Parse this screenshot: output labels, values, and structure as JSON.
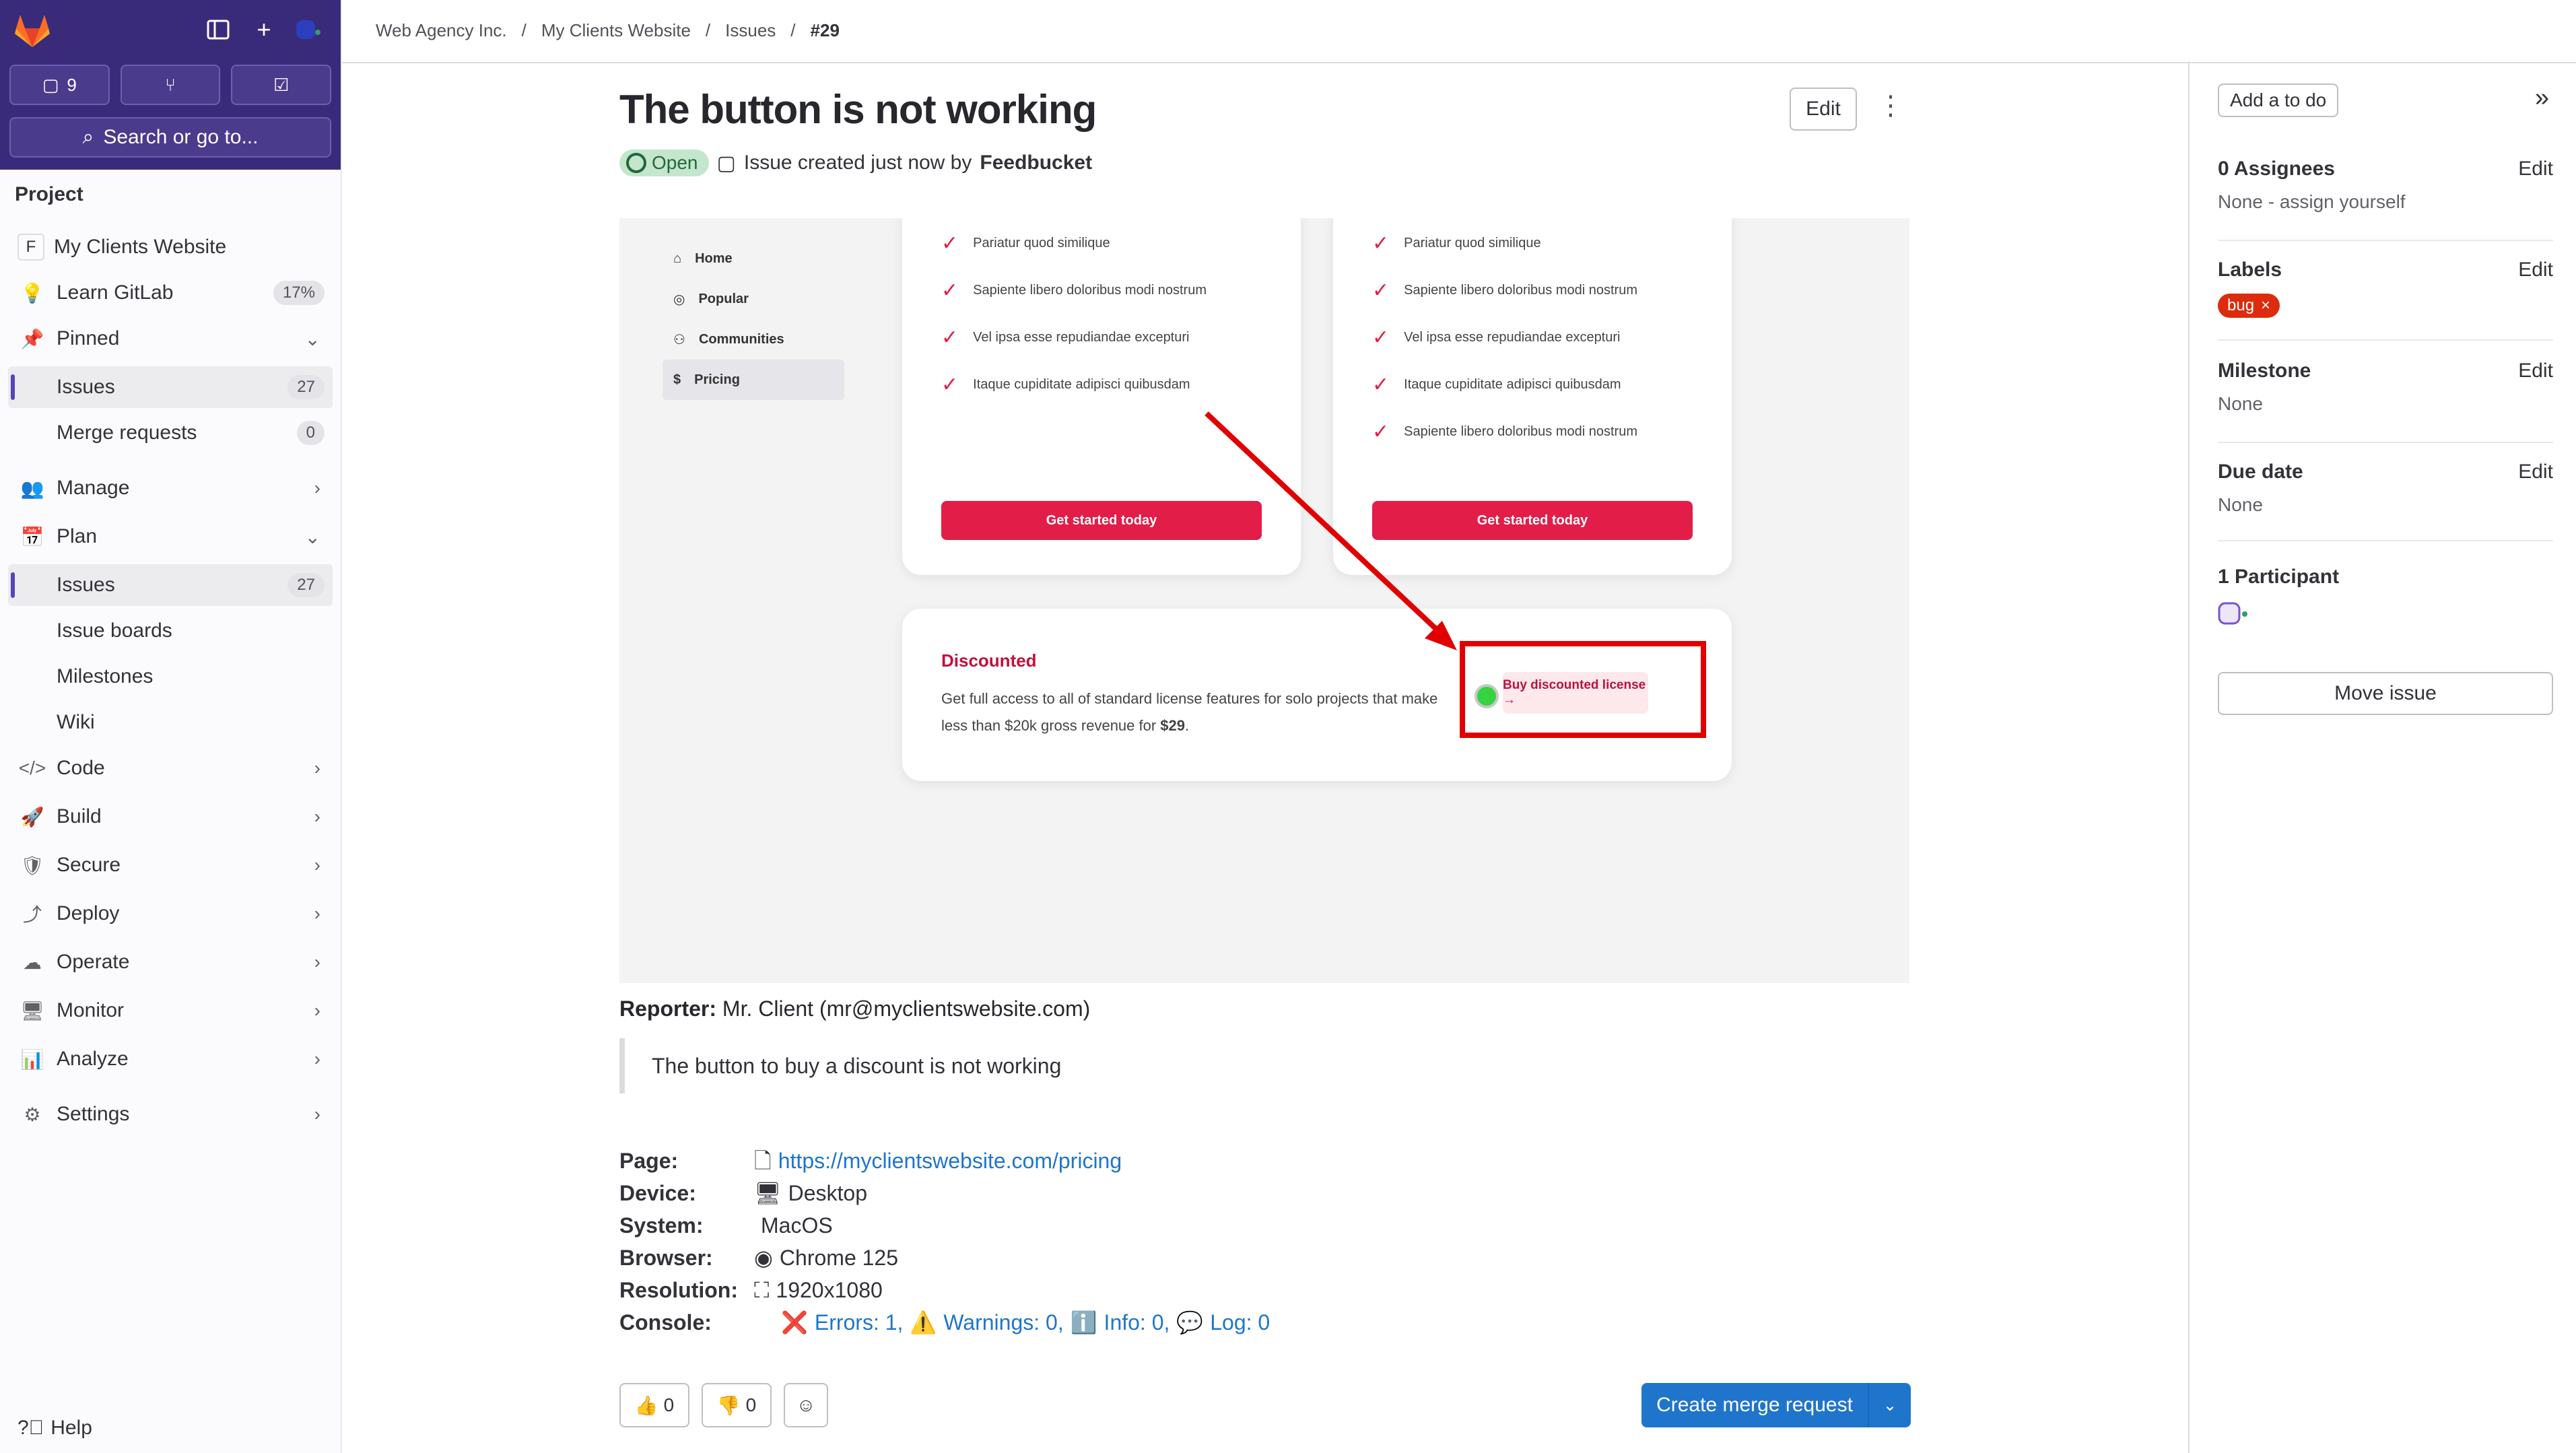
{
  "sidebar": {
    "counts": {
      "issues": "9"
    },
    "search_label": "Search or go to...",
    "section_label": "Project",
    "project_initial": "F",
    "project_name": "My Clients Website",
    "learn": {
      "label": "Learn GitLab",
      "badge": "17%"
    },
    "pinned": "Pinned",
    "pinned_issues": {
      "label": "Issues",
      "count": "27"
    },
    "pinned_mrs": {
      "label": "Merge requests",
      "count": "0"
    },
    "manage": "Manage",
    "plan": "Plan",
    "plan_issues": {
      "label": "Issues",
      "count": "27"
    },
    "issue_boards": "Issue boards",
    "milestones": "Milestones",
    "wiki": "Wiki",
    "code": "Code",
    "build": "Build",
    "secure": "Secure",
    "deploy": "Deploy",
    "operate": "Operate",
    "monitor": "Monitor",
    "analyze": "Analyze",
    "settings": "Settings",
    "help": "Help"
  },
  "breadcrumb": [
    "Web Agency Inc.",
    "My Clients Website",
    "Issues",
    "#29"
  ],
  "issue": {
    "title": "The button is not working",
    "status": "Open",
    "created_text": "Issue created just now by",
    "author": "Feedbucket",
    "edit_label": "Edit"
  },
  "screenshot": {
    "nav": [
      "Home",
      "Popular",
      "Communities",
      "Pricing"
    ],
    "card1_features": [
      "Pariatur quod similique",
      "Sapiente libero doloribus modi nostrum",
      "Vel ipsa esse repudiandae excepturi",
      "Itaque cupiditate adipisci quibusdam"
    ],
    "card2_features": [
      "Pariatur quod similique",
      "Sapiente libero doloribus modi nostrum",
      "Vel ipsa esse repudiandae excepturi",
      "Itaque cupiditate adipisci quibusdam",
      "Sapiente libero doloribus modi nostrum"
    ],
    "cta_label": "Get started today",
    "discount_title": "Discounted",
    "discount_text_a": "Get full access to all of standard license features for solo projects that make less than $20k gross revenue for ",
    "discount_price": "$29",
    "discount_text_b": ".",
    "discount_button": "Buy discounted license →"
  },
  "reporter": {
    "label": "Reporter:",
    "value": "Mr. Client (mr@myclientswebsite.com)"
  },
  "quote": "The button to buy a discount is not working",
  "details": {
    "page": {
      "k": "Page:",
      "v": "https://myclientswebsite.com/pricing"
    },
    "device": {
      "k": "Device:",
      "v": "Desktop"
    },
    "system": {
      "k": "System:",
      "v": "MacOS"
    },
    "browser": {
      "k": "Browser:",
      "v": "Chrome 125"
    },
    "resolution": {
      "k": "Resolution:",
      "v": "1920x1080"
    },
    "console": {
      "k": "Console:",
      "errors": "Errors: 1,",
      "warnings": "Warnings: 0,",
      "info": "Info: 0,",
      "log": "Log: 0"
    }
  },
  "reactions": {
    "thumbs_up": "0",
    "thumbs_down": "0"
  },
  "create_mr_label": "Create merge request",
  "right": {
    "todo": "Add a to do",
    "assignees": {
      "title": "0 Assignees",
      "edit": "Edit",
      "value": "None - assign yourself"
    },
    "labels": {
      "title": "Labels",
      "edit": "Edit",
      "bug": "bug"
    },
    "milestone": {
      "title": "Milestone",
      "edit": "Edit",
      "value": "None"
    },
    "due_date": {
      "title": "Due date",
      "edit": "Edit",
      "value": "None"
    },
    "participants": {
      "title": "1 Participant"
    },
    "move_issue": "Move issue"
  },
  "colors": {
    "accent": "#1f75cb",
    "sidebar_top": "#3a2b7a",
    "danger": "#e11d48",
    "status_open": "#24663b"
  }
}
